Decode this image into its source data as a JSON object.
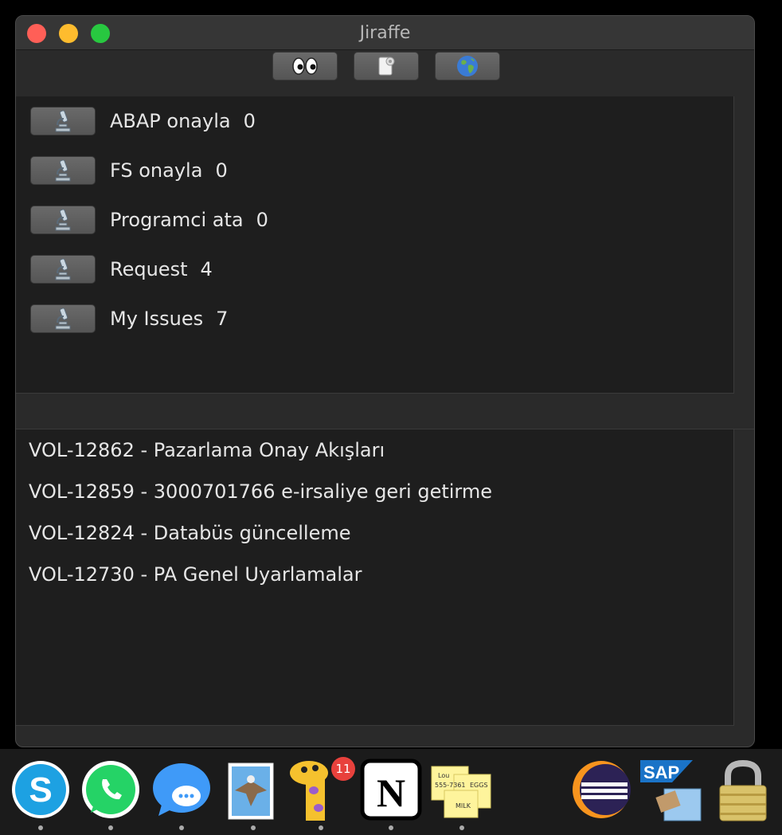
{
  "window": {
    "title": "Jiraffe"
  },
  "toolbar": [
    {
      "name": "eyes-button",
      "icon": "eyes-icon"
    },
    {
      "name": "toilet-paper-button",
      "icon": "toilet-paper-icon"
    },
    {
      "name": "globe-button",
      "icon": "globe-icon"
    }
  ],
  "queues": [
    {
      "label": "ABAP onayla",
      "count": "0",
      "icon": "microscope-icon"
    },
    {
      "label": "FS onayla",
      "count": "0",
      "icon": "microscope-icon"
    },
    {
      "label": "Programci ata",
      "count": "0",
      "icon": "microscope-icon"
    },
    {
      "label": "Request",
      "count": "4",
      "icon": "microscope-icon"
    },
    {
      "label": "My Issues",
      "count": "7",
      "icon": "microscope-icon"
    }
  ],
  "issues": [
    "VOL-12862 - Pazarlama Onay Akışları",
    "VOL-12859 - 3000701766 e-irsaliye geri getirme",
    "VOL-12824 - Databüs güncelleme",
    "VOL-12730 - PA Genel Uyarlamalar"
  ],
  "dock": {
    "apps": [
      "skype-icon",
      "whatsapp-icon",
      "messages-icon",
      "mail-icon",
      "jiraffe-icon",
      "notion-icon",
      "stickies-icon",
      "eclipse-icon",
      "sap-icon",
      "keychain-icon"
    ],
    "jiraffe_badge": "11",
    "skype_letter": "S",
    "notion_letter": "N",
    "sap_text": "SAP",
    "stickies_text": [
      "Lou",
      "555-7361",
      "EGGS",
      "MILK"
    ]
  }
}
